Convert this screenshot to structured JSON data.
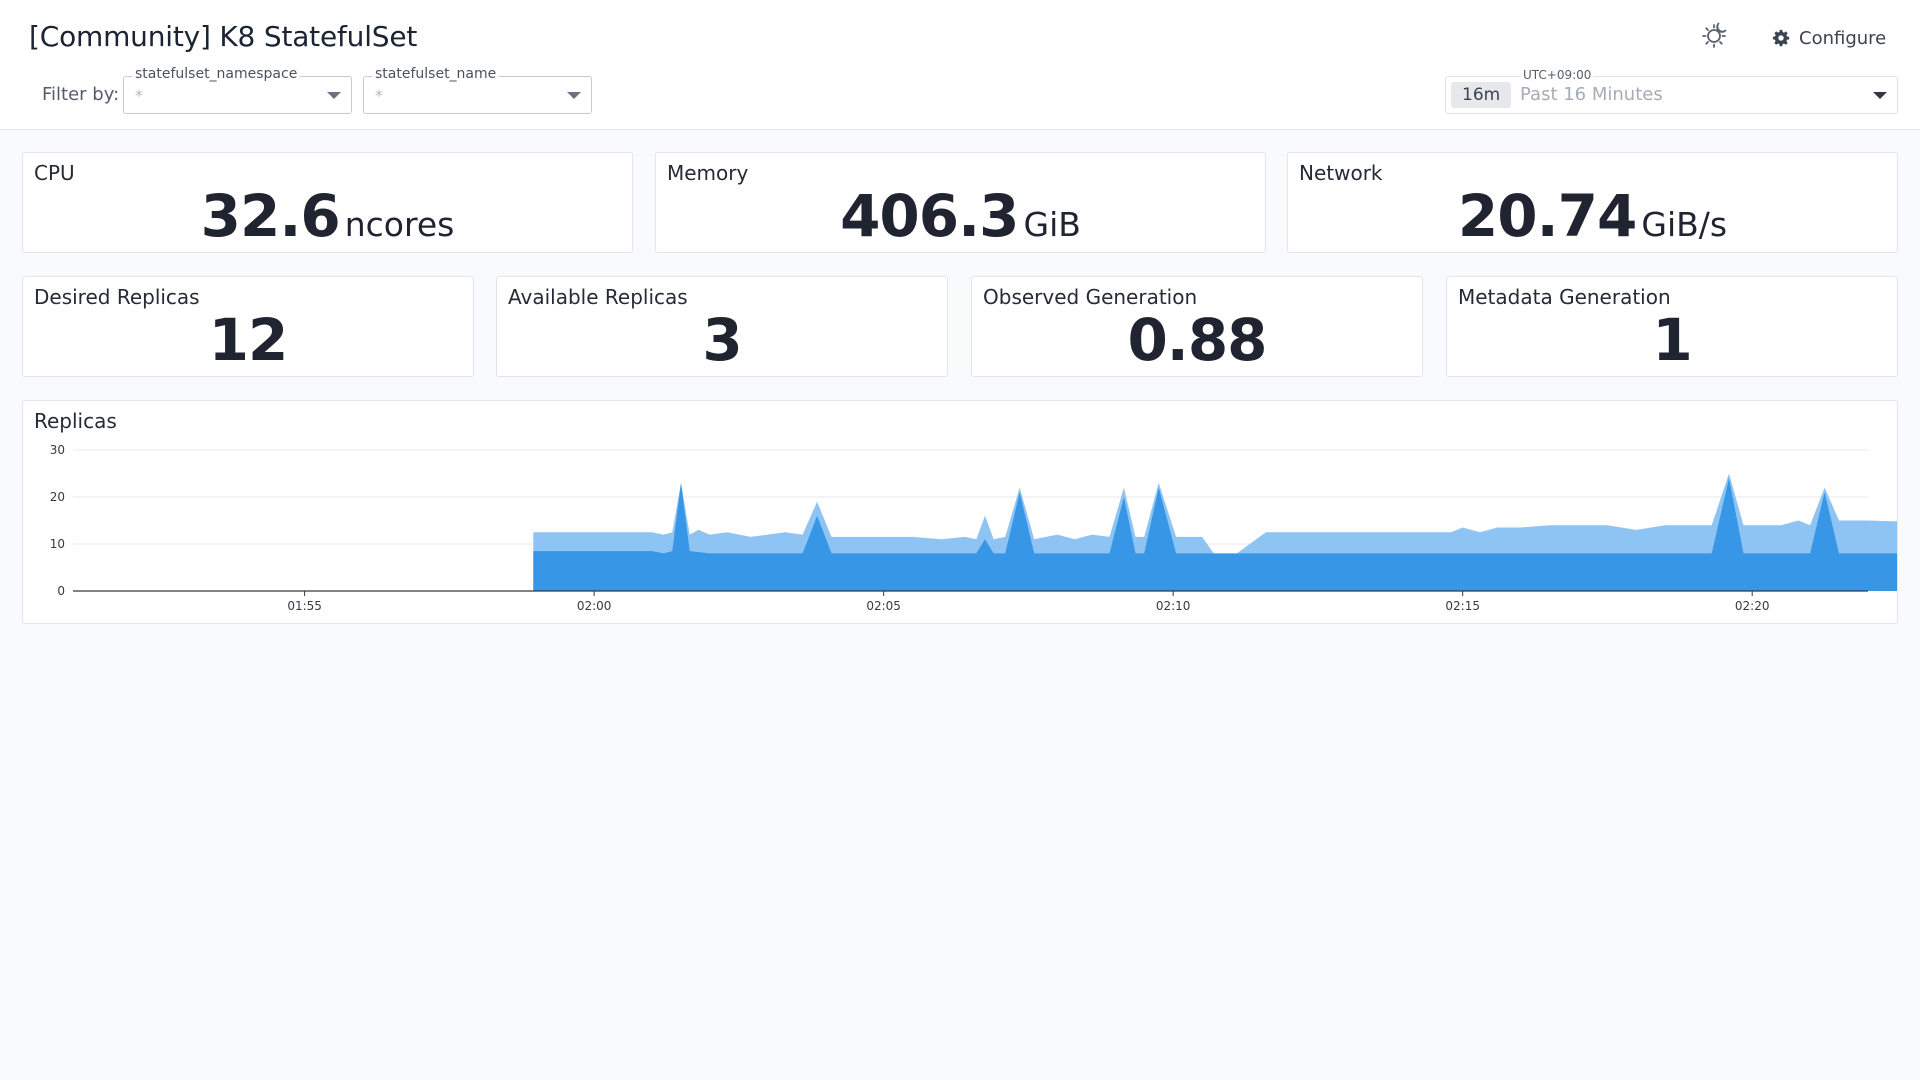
{
  "header": {
    "title": "[Community] K8 StatefulSet",
    "filter_label": "Filter by:",
    "filters": [
      {
        "label": "statefulset_namespace",
        "value": "*"
      },
      {
        "label": "statefulset_name",
        "value": "*"
      }
    ],
    "configure_label": "Configure",
    "timezone": "UTC+09:00",
    "time_badge": "16m",
    "time_range": "Past 16 Minutes"
  },
  "metrics_row1": [
    {
      "title": "CPU",
      "value": "32.6",
      "unit": "ncores"
    },
    {
      "title": "Memory",
      "value": "406.3",
      "unit": "GiB"
    },
    {
      "title": "Network",
      "value": "20.74",
      "unit": "GiB/s"
    }
  ],
  "metrics_row2": [
    {
      "title": "Desired Replicas",
      "value": "12"
    },
    {
      "title": "Available Replicas",
      "value": "3"
    },
    {
      "title": "Observed Generation",
      "value": "0.88"
    },
    {
      "title": "Metadata Generation",
      "value": "1"
    }
  ],
  "colors": {
    "series_dark": "#3796e6",
    "series_light": "#8ec4f3",
    "grid": "#e6e8ec",
    "axis": "#333a45"
  },
  "chart_data": {
    "type": "area",
    "title": "Replicas",
    "stacked": true,
    "ylim": [
      0,
      30
    ],
    "y_ticks": [
      0,
      10,
      20,
      30
    ],
    "x_ticks": [
      "01:55",
      "02:00",
      "02:05",
      "02:10",
      "02:15",
      "02:20"
    ],
    "x_range_minutes": [
      -4,
      27
    ],
    "grid": true,
    "series": [
      {
        "points": [
          [
            3.95,
            0
          ],
          [
            3.95,
            8.5
          ],
          [
            6.0,
            8.5
          ],
          [
            6.2,
            8.0
          ],
          [
            6.35,
            8.5
          ],
          [
            6.5,
            23.0
          ],
          [
            6.65,
            8.5
          ],
          [
            7.0,
            8.0
          ],
          [
            7.5,
            8.0
          ],
          [
            8.6,
            8.0
          ],
          [
            8.85,
            16.0
          ],
          [
            9.1,
            8.0
          ],
          [
            11.6,
            8.0
          ],
          [
            11.75,
            11.0
          ],
          [
            11.9,
            8.0
          ],
          [
            12.1,
            8.0
          ],
          [
            12.35,
            21.0
          ],
          [
            12.6,
            8.0
          ],
          [
            13.9,
            8.0
          ],
          [
            14.15,
            20.0
          ],
          [
            14.35,
            8.0
          ],
          [
            14.5,
            8.0
          ],
          [
            14.75,
            22.0
          ],
          [
            15.05,
            8.0
          ],
          [
            17.0,
            8.0
          ],
          [
            20.0,
            8.0
          ],
          [
            20.6,
            8.0
          ],
          [
            24.0,
            8.0
          ],
          [
            24.3,
            8.0
          ],
          [
            24.6,
            24.0
          ],
          [
            24.85,
            8.0
          ],
          [
            26.0,
            8.0
          ],
          [
            26.25,
            21.0
          ],
          [
            26.5,
            8.0
          ],
          [
            28.4,
            8.0
          ],
          [
            28.4,
            0
          ]
        ]
      },
      {
        "points": [
          [
            3.95,
            0
          ],
          [
            3.95,
            12.5
          ],
          [
            6.0,
            12.5
          ],
          [
            6.2,
            12.0
          ],
          [
            6.35,
            12.5
          ],
          [
            6.5,
            23.0
          ],
          [
            6.65,
            12.0
          ],
          [
            6.8,
            13.0
          ],
          [
            7.0,
            12.0
          ],
          [
            7.3,
            12.5
          ],
          [
            7.7,
            11.5
          ],
          [
            8.0,
            12.0
          ],
          [
            8.3,
            12.5
          ],
          [
            8.6,
            12.0
          ],
          [
            8.85,
            19.0
          ],
          [
            9.1,
            11.5
          ],
          [
            10.5,
            11.5
          ],
          [
            11.0,
            11.0
          ],
          [
            11.4,
            11.5
          ],
          [
            11.6,
            11.0
          ],
          [
            11.75,
            16.0
          ],
          [
            11.9,
            11.0
          ],
          [
            12.1,
            11.5
          ],
          [
            12.35,
            22.0
          ],
          [
            12.6,
            11.0
          ],
          [
            13.0,
            12.0
          ],
          [
            13.3,
            11.0
          ],
          [
            13.6,
            12.0
          ],
          [
            13.9,
            11.5
          ],
          [
            14.15,
            22.0
          ],
          [
            14.35,
            11.5
          ],
          [
            14.5,
            11.5
          ],
          [
            14.75,
            23.0
          ],
          [
            15.05,
            11.5
          ],
          [
            15.5,
            11.5
          ],
          [
            15.7,
            8.0
          ],
          [
            16.1,
            8.0
          ],
          [
            16.6,
            12.5
          ],
          [
            17.5,
            12.5
          ],
          [
            19.8,
            12.5
          ],
          [
            20.0,
            13.5
          ],
          [
            20.3,
            12.5
          ],
          [
            20.6,
            13.5
          ],
          [
            21.0,
            13.5
          ],
          [
            21.5,
            14.0
          ],
          [
            22.5,
            14.0
          ],
          [
            23.0,
            13.0
          ],
          [
            23.5,
            14.0
          ],
          [
            24.3,
            14.0
          ],
          [
            24.6,
            25.0
          ],
          [
            24.85,
            14.0
          ],
          [
            25.5,
            14.0
          ],
          [
            25.8,
            15.0
          ],
          [
            26.0,
            14.0
          ],
          [
            26.25,
            22.0
          ],
          [
            26.5,
            15.0
          ],
          [
            27.0,
            15.0
          ],
          [
            28.4,
            14.5
          ],
          [
            28.4,
            0
          ]
        ]
      }
    ]
  }
}
